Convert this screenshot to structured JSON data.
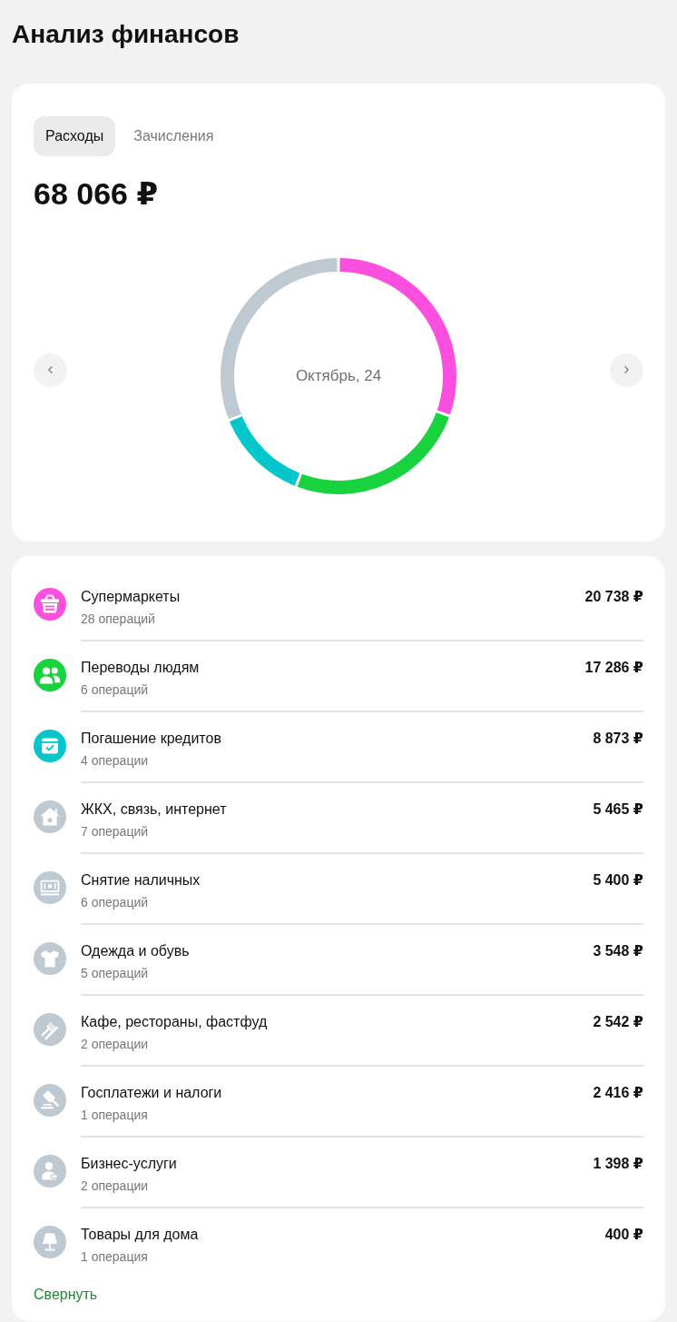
{
  "page": {
    "title": "Анализ финансов"
  },
  "summary": {
    "tabs": [
      {
        "label": "Расходы",
        "selected": true
      },
      {
        "label": "Зачисления",
        "selected": false
      }
    ],
    "total": "68 066 ₽",
    "chart_data": {
      "type": "donut",
      "title": "Октябрь, 24",
      "values": [
        30.47,
        25.4,
        13.04,
        31.09
      ],
      "colors": [
        "#fd4fdf",
        "#18d33e",
        "#05c6cb",
        "#bfc9d2"
      ]
    }
  },
  "categories": [
    {
      "name": "Супермаркеты",
      "operations": "28 операций",
      "amount": "20 738 ₽",
      "color": "#fd4fdf"
    },
    {
      "name": "Переводы людям",
      "operations": "6 операций",
      "amount": "17 286 ₽",
      "color": "#18d33e"
    },
    {
      "name": "Погашение кредитов",
      "operations": "4 операции",
      "amount": "8 873 ₽",
      "color": "#05c6cb"
    },
    {
      "name": "ЖКХ, связь, интернет",
      "operations": "7 операций",
      "amount": "5 465 ₽",
      "color": "#bfc9d2"
    },
    {
      "name": "Снятие наличных",
      "operations": "6 операций",
      "amount": "5 400 ₽",
      "color": "#bfc9d2"
    },
    {
      "name": "Одежда и обувь",
      "operations": "5 операций",
      "amount": "3 548 ₽",
      "color": "#bfc9d2"
    },
    {
      "name": "Кафе, рестораны, фастфуд",
      "operations": "2 операции",
      "amount": "2 542 ₽",
      "color": "#bfc9d2"
    },
    {
      "name": "Госплатежи и налоги",
      "operations": "1 операция",
      "amount": "2 416 ₽",
      "color": "#bfc9d2"
    },
    {
      "name": "Бизнес-услуги",
      "operations": "2 операции",
      "amount": "1 398 ₽",
      "color": "#bfc9d2"
    },
    {
      "name": "Товары для дома",
      "operations": "1 операция",
      "amount": "400 ₽",
      "color": "#bfc9d2"
    }
  ],
  "collapse_link": "Свернуть"
}
